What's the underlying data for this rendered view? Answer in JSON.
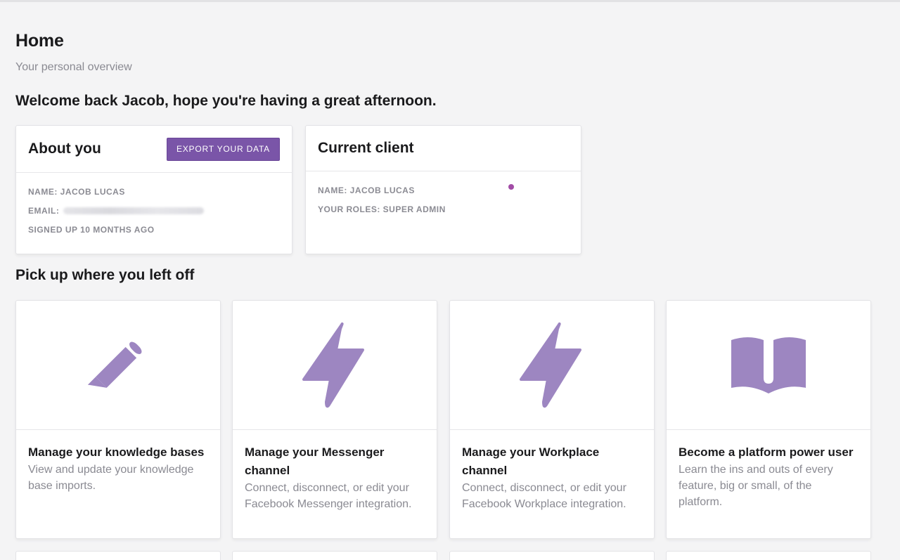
{
  "header": {
    "title": "Home",
    "subtitle": "Your personal overview"
  },
  "welcome": "Welcome back Jacob, hope you're having a great afternoon.",
  "about": {
    "title": "About you",
    "export_label": "EXPORT YOUR DATA",
    "name": "NAME: JACOB LUCAS",
    "email_label": "EMAIL:",
    "signed_up": "SIGNED UP 10 MONTHS AGO"
  },
  "client": {
    "title": "Current client",
    "name": "NAME: JACOB LUCAS",
    "roles": "YOUR ROLES: SUPER ADMIN"
  },
  "section_title": "Pick up where you left off",
  "tiles": [
    {
      "title": "Manage your knowledge bases",
      "desc": "View and update your knowledge base imports.",
      "icon": "pencil-icon"
    },
    {
      "title": "Manage your Messenger channel",
      "desc": "Connect, disconnect, or edit your Facebook Messenger integration.",
      "icon": "lightning-icon"
    },
    {
      "title": "Manage your Workplace channel",
      "desc": "Connect, disconnect, or edit your Facebook Workplace integration.",
      "icon": "lightning-icon"
    },
    {
      "title": "Become a platform power user",
      "desc": "Learn the ins and outs of every feature, big or small, of the platform.",
      "icon": "book-icon"
    }
  ],
  "colors": {
    "accent": "#7a55a8",
    "icon": "#9d86c1",
    "status_dot": "#a24ca6"
  }
}
